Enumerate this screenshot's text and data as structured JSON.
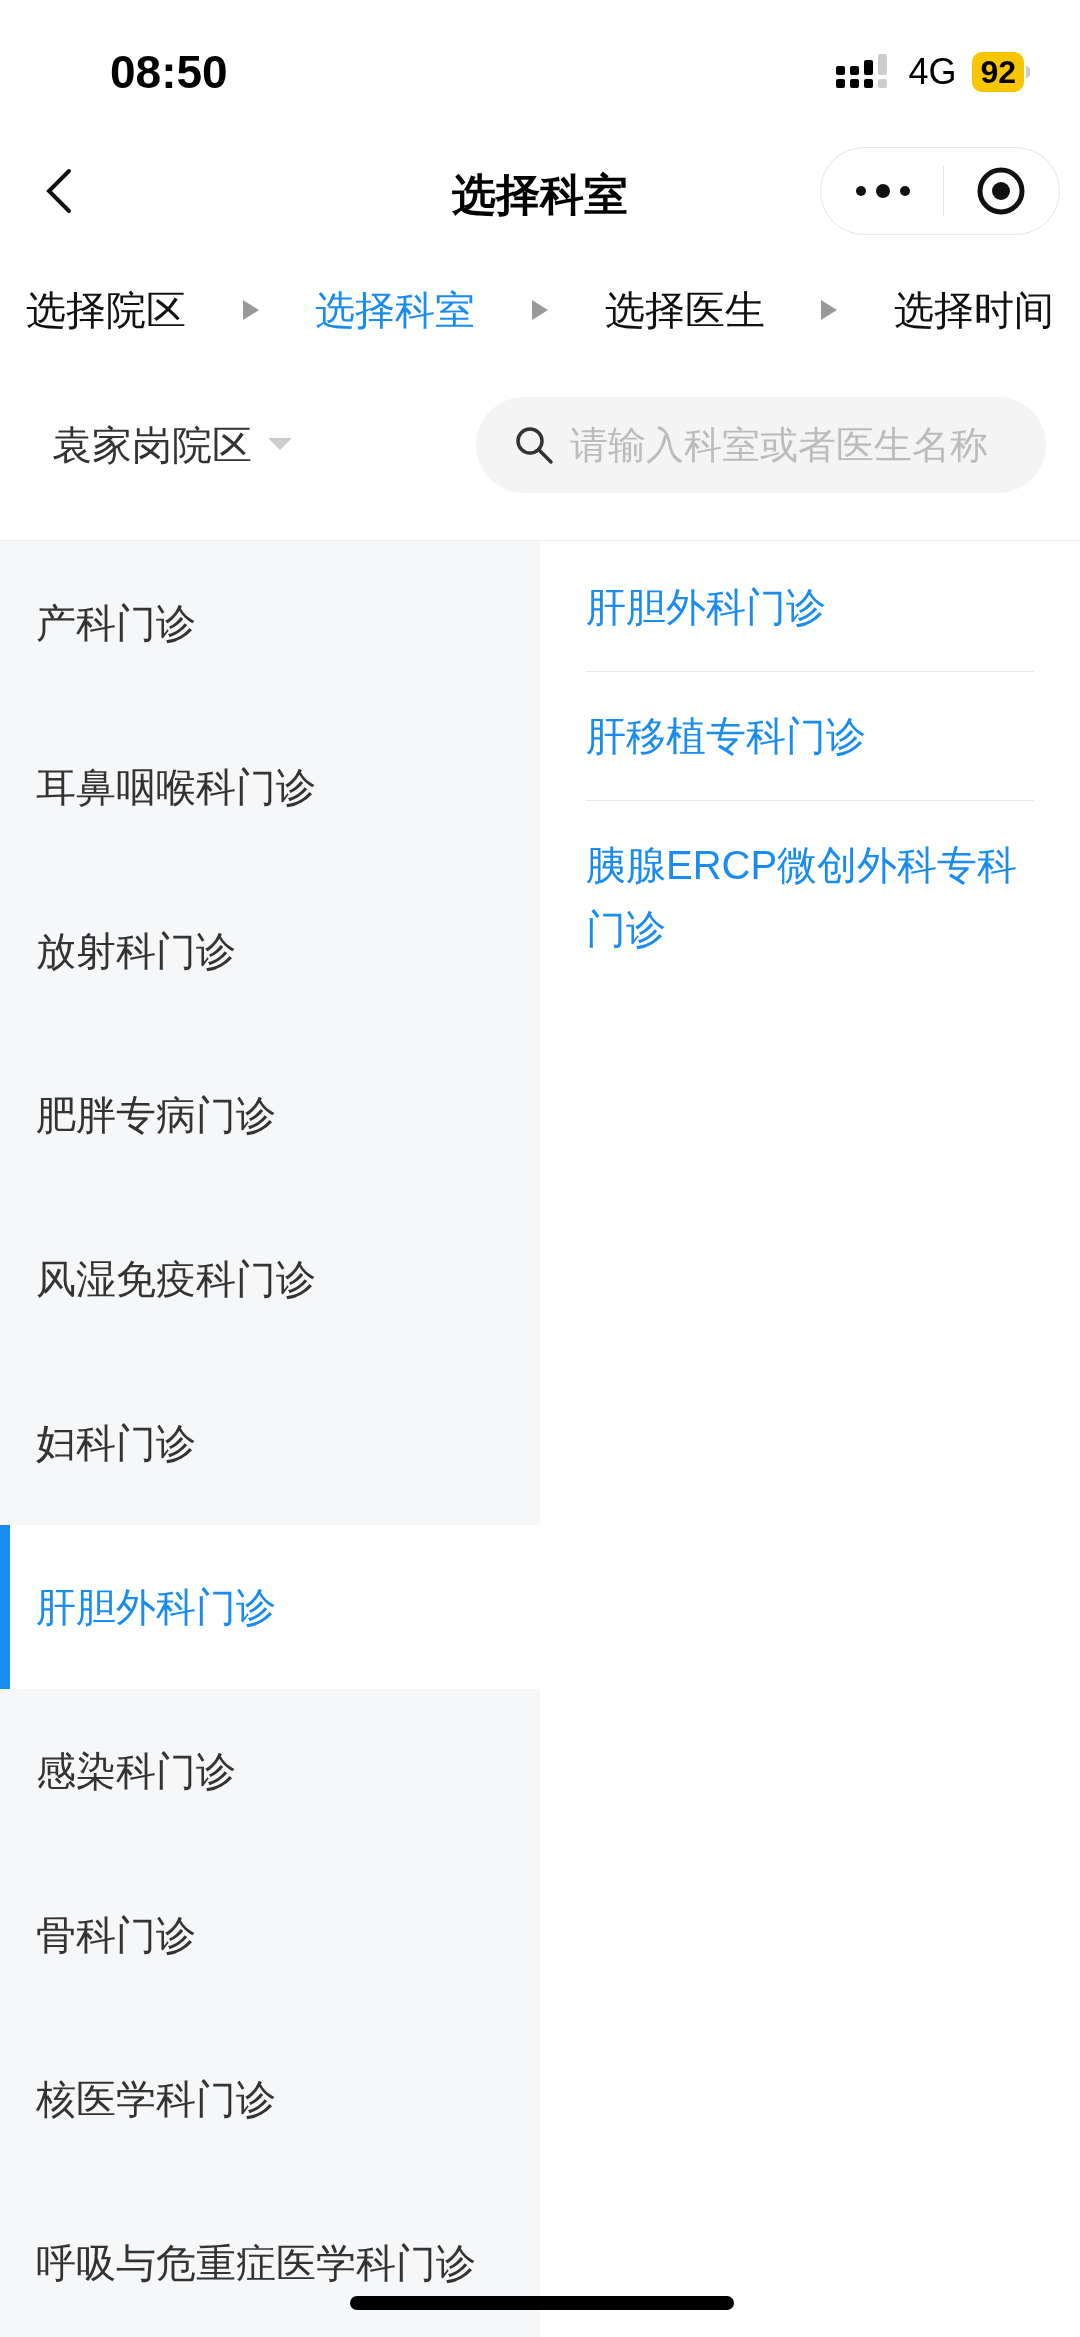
{
  "status_bar": {
    "time": "08:50",
    "network": "4G",
    "battery": "92"
  },
  "nav": {
    "title": "选择科室"
  },
  "steps": [
    {
      "label": "选择院区",
      "selected": false
    },
    {
      "label": "选择科室",
      "selected": true
    },
    {
      "label": "选择医生",
      "selected": false
    },
    {
      "label": "选择时间",
      "selected": false
    }
  ],
  "campus": {
    "label": "袁家岗院区"
  },
  "search": {
    "placeholder": "请输入科室或者医生名称"
  },
  "departments": [
    {
      "label": "产科门诊",
      "selected": false
    },
    {
      "label": "耳鼻咽喉科门诊",
      "selected": false
    },
    {
      "label": "放射科门诊",
      "selected": false
    },
    {
      "label": "肥胖专病门诊",
      "selected": false
    },
    {
      "label": "风湿免疫科门诊",
      "selected": false
    },
    {
      "label": "妇科门诊",
      "selected": false
    },
    {
      "label": "肝胆外科门诊",
      "selected": true
    },
    {
      "label": "感染科门诊",
      "selected": false
    },
    {
      "label": "骨科门诊",
      "selected": false
    },
    {
      "label": "核医学科门诊",
      "selected": false
    },
    {
      "label": "呼吸与危重症医学科门诊",
      "selected": false
    }
  ],
  "clinics": [
    {
      "label": "肝胆外科门诊"
    },
    {
      "label": "肝移植专科门诊"
    },
    {
      "label": "胰腺ERCP微创外科专科门诊"
    }
  ]
}
